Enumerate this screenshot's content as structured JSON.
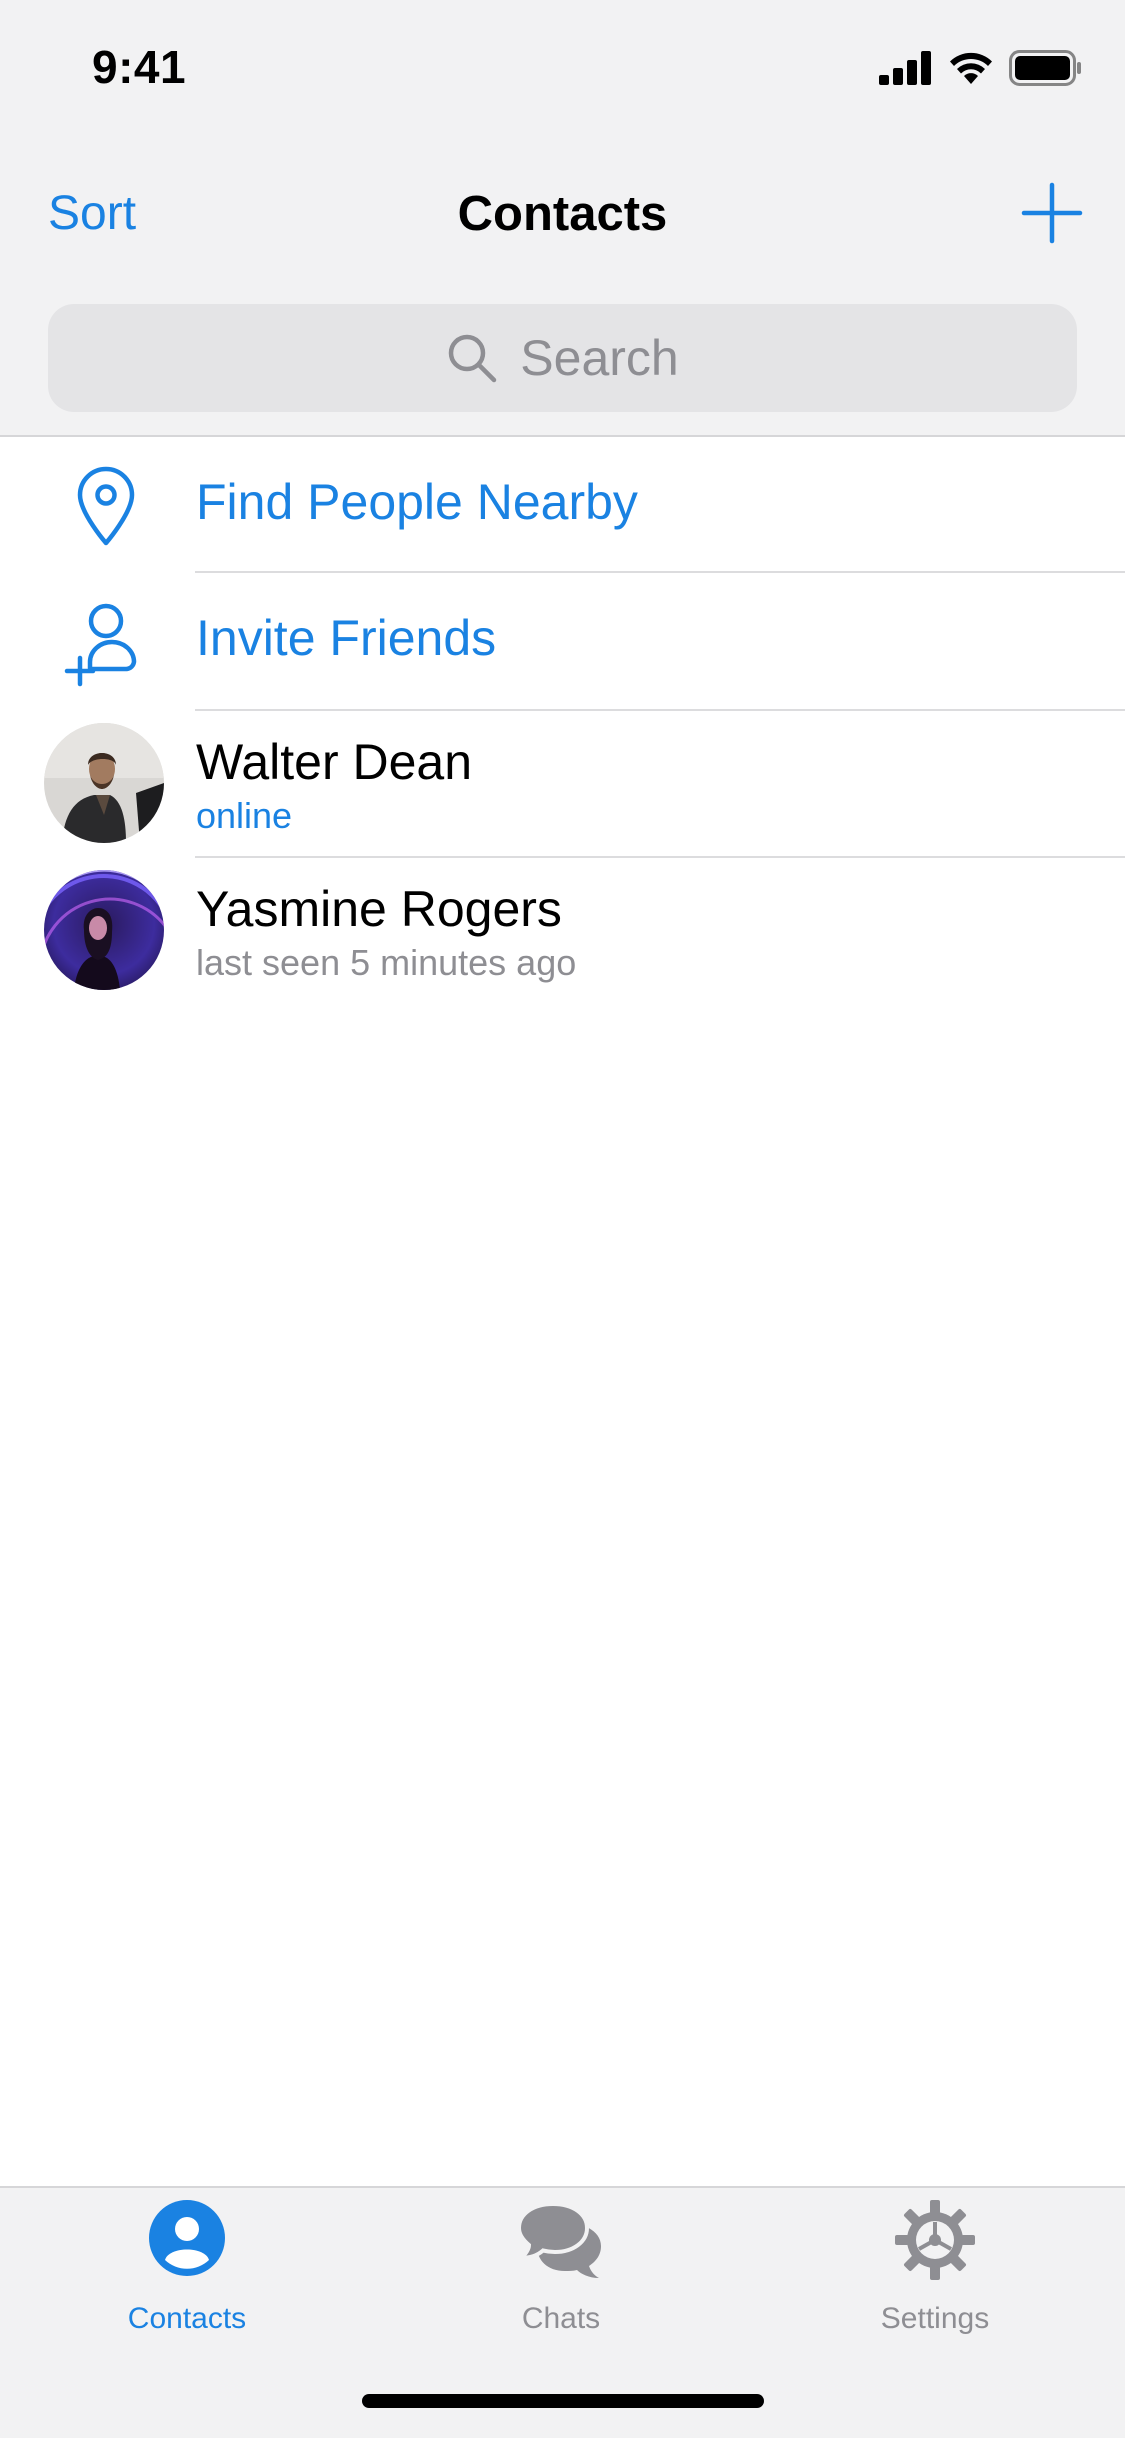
{
  "status_bar": {
    "time": "9:41"
  },
  "nav": {
    "sort_label": "Sort",
    "title": "Contacts",
    "add_icon": "plus-icon"
  },
  "search": {
    "placeholder": "Search"
  },
  "actions": [
    {
      "label": "Find People Nearby",
      "icon": "location-pin-icon"
    },
    {
      "label": "Invite Friends",
      "icon": "add-person-icon"
    }
  ],
  "contacts": [
    {
      "first_name": "Walter",
      "last_name": "Dean",
      "status": "online",
      "status_color": "#1a82e2"
    },
    {
      "first_name": "Yasmine",
      "last_name": "Rogers",
      "status": "last seen 5 minutes ago",
      "status_color": "#8e8e93"
    }
  ],
  "tabs": [
    {
      "label": "Contacts",
      "icon": "person-circle-icon",
      "active": true
    },
    {
      "label": "Chats",
      "icon": "chat-bubbles-icon",
      "active": false
    },
    {
      "label": "Settings",
      "icon": "gear-icon",
      "active": false
    }
  ],
  "colors": {
    "accent": "#1a82e2",
    "inactive": "#8e8e93",
    "bar_bg": "#f2f2f3"
  }
}
